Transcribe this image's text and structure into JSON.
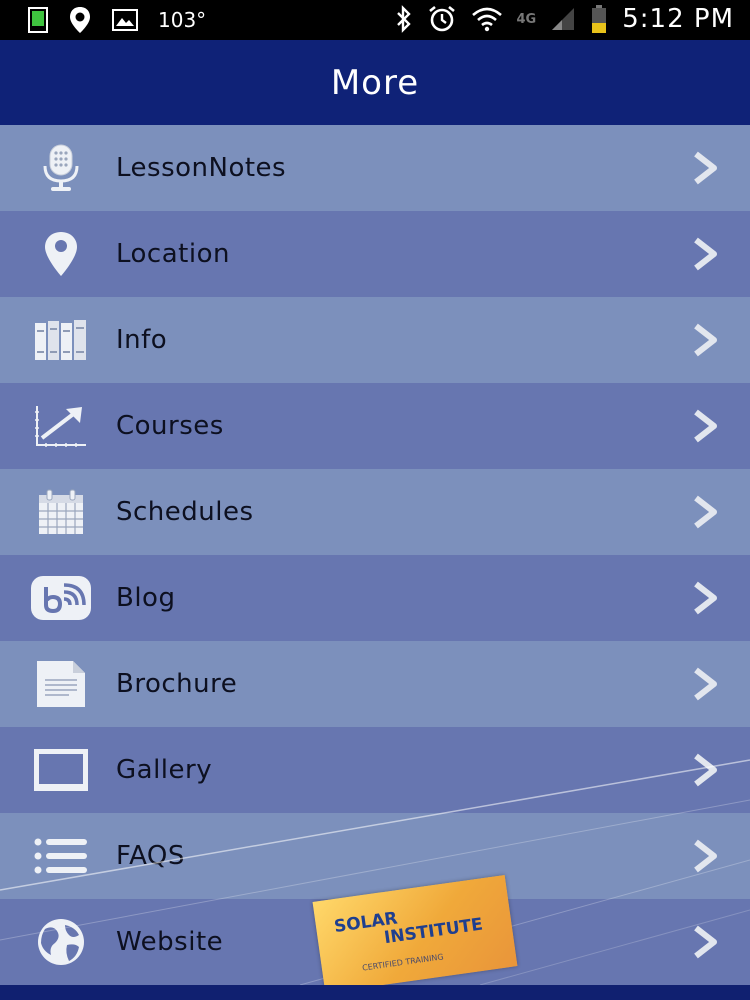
{
  "status_bar": {
    "temperature": "103°",
    "network": "4G",
    "time": "5:12 PM",
    "icons": [
      "notification-icon",
      "location-icon",
      "image-icon",
      "bluetooth-icon",
      "alarm-icon",
      "wifi-icon",
      "signal-icon",
      "battery-icon"
    ]
  },
  "header": {
    "title": "More"
  },
  "menu": {
    "items": [
      {
        "label": "LessonNotes",
        "icon": "microphone-icon"
      },
      {
        "label": "Location",
        "icon": "map-pin-icon"
      },
      {
        "label": "Info",
        "icon": "books-icon"
      },
      {
        "label": "Courses",
        "icon": "growth-chart-icon"
      },
      {
        "label": "Schedules",
        "icon": "calendar-icon"
      },
      {
        "label": "Blog",
        "icon": "blog-icon"
      },
      {
        "label": "Brochure",
        "icon": "document-icon"
      },
      {
        "label": "Gallery",
        "icon": "picture-frame-icon"
      },
      {
        "label": "FAQS",
        "icon": "list-icon"
      },
      {
        "label": "Website",
        "icon": "globe-icon"
      }
    ]
  },
  "badge": {
    "line1": "SOLAR",
    "line2": "INSTITUTE",
    "line3": "CERTIFIED TRAINING"
  },
  "colors": {
    "status_bar": "#000000",
    "header": "#0f2277",
    "row_light": "#7c90bc",
    "row_dark": "#6776b0",
    "text": "#0d1020"
  }
}
